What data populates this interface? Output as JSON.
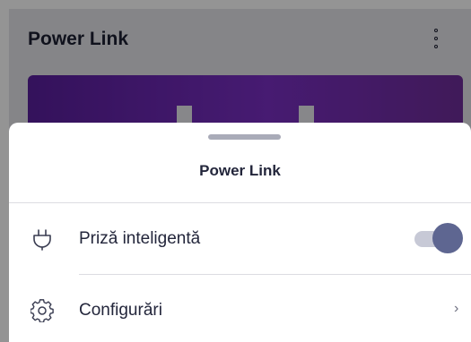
{
  "app": {
    "title": "Power Link",
    "more_icon": "more-vertical-icon",
    "card_color": "#6b2ab0"
  },
  "sheet": {
    "title": "Power Link",
    "items": [
      {
        "icon": "plug-icon",
        "label": "Priză inteligentă",
        "control": "toggle",
        "toggle_on": true
      },
      {
        "icon": "gear-icon",
        "label": "Configurări",
        "control": "chevron",
        "chevron": "›"
      }
    ]
  },
  "colors": {
    "text": "#23263b",
    "toggle_knob": "#5e6691",
    "toggle_track": "#c7c9d6",
    "divider": "#dcdce2"
  }
}
